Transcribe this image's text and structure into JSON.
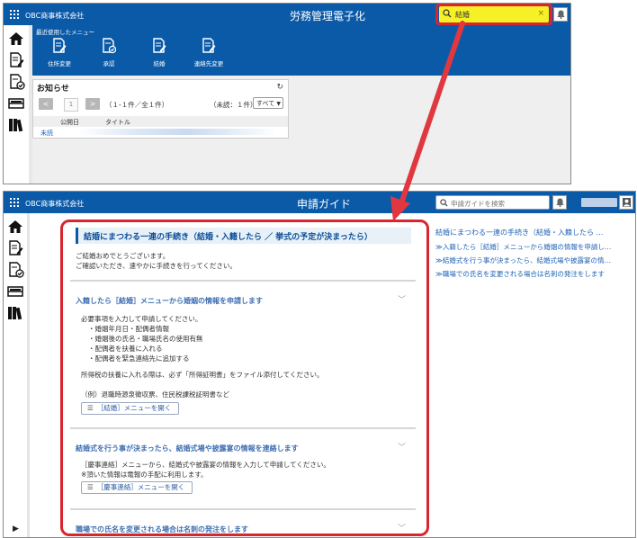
{
  "colors": {
    "brand_blue": "#0a5aa8",
    "highlight_red": "#d8262f",
    "search_yellow": "#f6f026",
    "link_blue": "#1f63b5"
  },
  "top_window": {
    "company": "OBC商事株式会社",
    "app_title": "労務管理電子化",
    "search": {
      "value": "結婚",
      "clear_icon": "×",
      "icon": "search-icon"
    },
    "bell_icon": "bell-icon",
    "sidebar_icons": [
      "home-icon",
      "document-edit-icon",
      "document-check-icon",
      "inbox-icon",
      "library-icon"
    ],
    "recent_menu": {
      "heading": "最近使用したメニュー",
      "items": [
        {
          "label": "住所変更",
          "icon": "document-edit-icon"
        },
        {
          "label": "承認",
          "icon": "document-check-icon"
        },
        {
          "label": "結婚",
          "icon": "document-edit-icon"
        },
        {
          "label": "連絡先変更",
          "icon": "document-edit-icon"
        }
      ]
    },
    "notices": {
      "title": "お知らせ",
      "refresh_icon": "↻",
      "prev": "<",
      "page": "1",
      "next": ">",
      "range": "（１-１件／全１件）",
      "unread": "（未読：１件）",
      "filter": "すべて",
      "col_date": "公開日",
      "col_title": "タイトル",
      "row_status": "未読"
    }
  },
  "bottom_window": {
    "company": "OBC商事株式会社",
    "app_title": "申請ガイド",
    "search_placeholder": "申請ガイドを検索",
    "bell_icon": "bell-icon",
    "user_icon": "user-icon",
    "sidebar_icons": [
      "home-icon",
      "document-edit-icon",
      "document-check-icon",
      "inbox-icon",
      "library-icon"
    ],
    "expand_arrow": "▶",
    "guide": {
      "title": "結婚にまつわる一連の手続き（結婚・入籍したら ／ 挙式の予定が決まったら）",
      "intro_1": "ご結婚おめでとうございます。",
      "intro_2": "ご確認いただき、速やかに手続きを行ってください。",
      "sections": [
        {
          "title": "入籍したら［結婚］メニューから婚姻の情報を申請します",
          "lines": [
            "必要事項を入力して申請してください。",
            "・婚姻年月日・配偶者情報",
            "・婚姻後の氏名・職場氏名の使用有無",
            "・配偶者を扶養に入れる",
            "・配偶者を緊急連絡先に追加する",
            "所得税の扶養に入れる際は、必ず「所得証明書」をファイル添付してください。",
            "（例）退職時源泉徴収票、住民税課税証明書など"
          ],
          "button": "［結婚］メニューを開く"
        },
        {
          "title": "結婚式を行う事が決まったら、結婚式場や披露宴の情報を連絡します",
          "lines": [
            "［慶事連絡］メニューから、結婚式や披露宴の情報を入力して申請してください。",
            "※頂いた情報は電報の手配に利用します。"
          ],
          "button": "［慶事連絡］メニューを開く"
        },
        {
          "title": "職場での氏名を変更される場合は名刺の発注をします",
          "lines": [],
          "button": ""
        }
      ],
      "chevron": "﹀",
      "list_icon": "☰"
    },
    "toc": {
      "heading": "結婚にまつわる一連の手続き（結婚・入籍したら …",
      "items": [
        "入籍したら［結婚］メニューから婚姻の情報を申請し…",
        "結婚式を行う事が決まったら、結婚式場や披露宴の情…",
        "職場での氏名を変更される場合は名刺の発注をします"
      ],
      "marker": "≫"
    }
  }
}
